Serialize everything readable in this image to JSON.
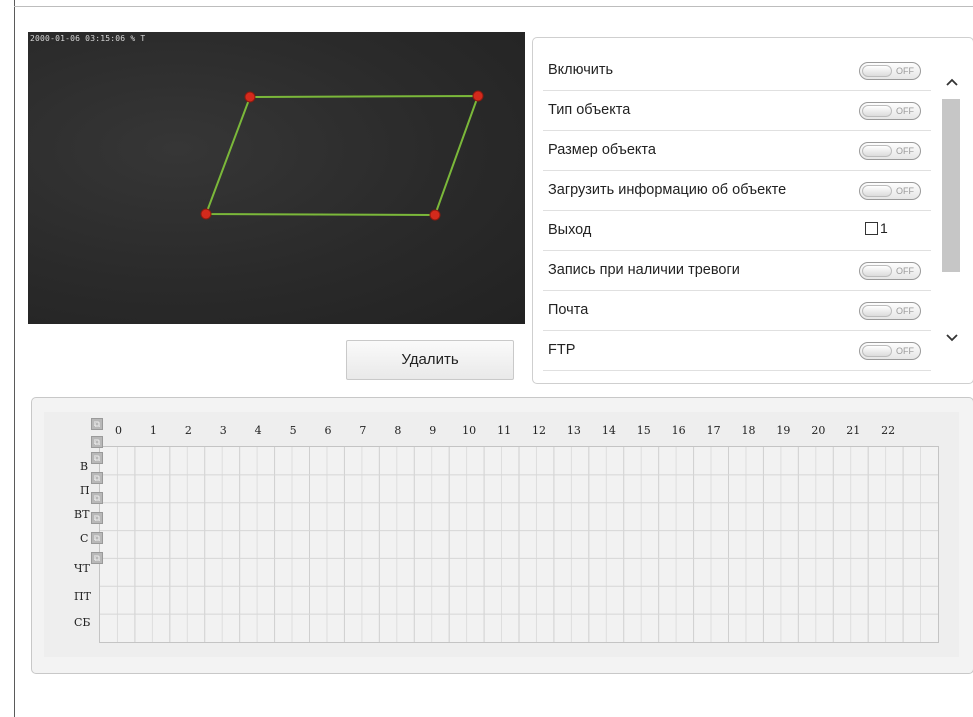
{
  "preview": {
    "osd_text": "2000-01-06 03:15:06 % T"
  },
  "delete_button": "Удалить",
  "settings": {
    "rows": [
      {
        "label": "Включить",
        "control": "toggle",
        "state": "OFF"
      },
      {
        "label": "Тип объекта",
        "control": "toggle",
        "state": "OFF"
      },
      {
        "label": "Размер объекта",
        "control": "toggle",
        "state": "OFF"
      },
      {
        "label": "Загрузить информацию об объекте",
        "control": "toggle",
        "state": "OFF"
      },
      {
        "label": "Выход",
        "control": "checkbox",
        "checkbox_label": "1"
      },
      {
        "label": "Запись при наличии тревоги",
        "control": "toggle",
        "state": "OFF"
      },
      {
        "label": "Почта",
        "control": "toggle",
        "state": "OFF"
      },
      {
        "label": "FTP",
        "control": "toggle",
        "state": "OFF"
      }
    ],
    "scroll_up_icon": "chevron-up-icon",
    "scroll_down_icon": "chevron-down-icon"
  },
  "schedule": {
    "hours": [
      "0",
      "1",
      "2",
      "3",
      "4",
      "5",
      "6",
      "7",
      "8",
      "9",
      "10",
      "11",
      "12",
      "13",
      "14",
      "15",
      "16",
      "17",
      "18",
      "19",
      "20",
      "21",
      "22"
    ],
    "days": [
      "В",
      "П",
      "ВТ",
      "С",
      "ЧТ",
      "ПТ",
      "СБ"
    ],
    "copy_icon": "copy-icon"
  },
  "colors": {
    "polygon": "#7bb83a",
    "vertex": "#d42a1c"
  }
}
